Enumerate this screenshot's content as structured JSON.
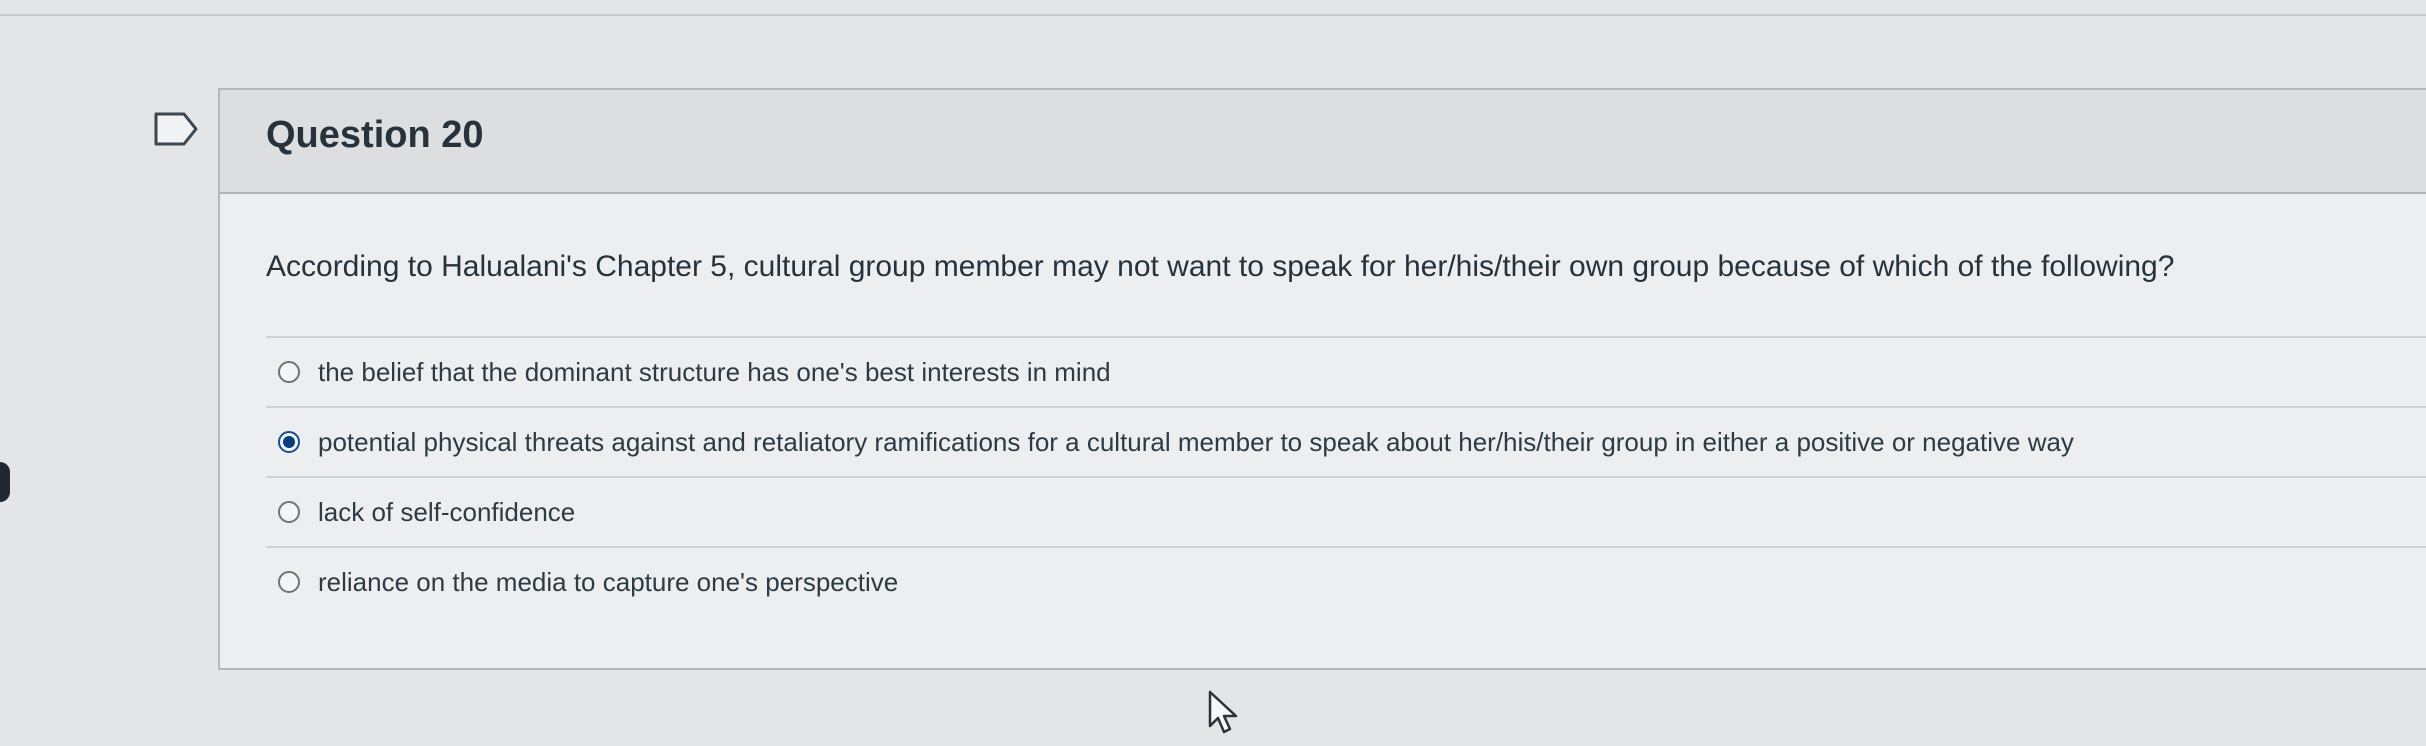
{
  "question": {
    "title": "Question 20",
    "text": "According to Halualani's Chapter 5, cultural group member may not want to speak for her/his/their own group because of which of the following?",
    "options": [
      {
        "label": "the belief that the dominant structure has one's best interests in mind",
        "selected": false
      },
      {
        "label": "potential physical threats against and retaliatory ramifications for a cultural member to speak about her/his/their group in either a positive or negative way",
        "selected": true
      },
      {
        "label": "lack of self-confidence",
        "selected": false
      },
      {
        "label": "reliance on the media to capture one's perspective",
        "selected": false
      }
    ]
  },
  "icons": {
    "flag": "flag-icon",
    "cursor": "mouse-pointer-icon"
  },
  "colors": {
    "selected_radio": "#0a3d7a",
    "text": "#2d3b45"
  }
}
